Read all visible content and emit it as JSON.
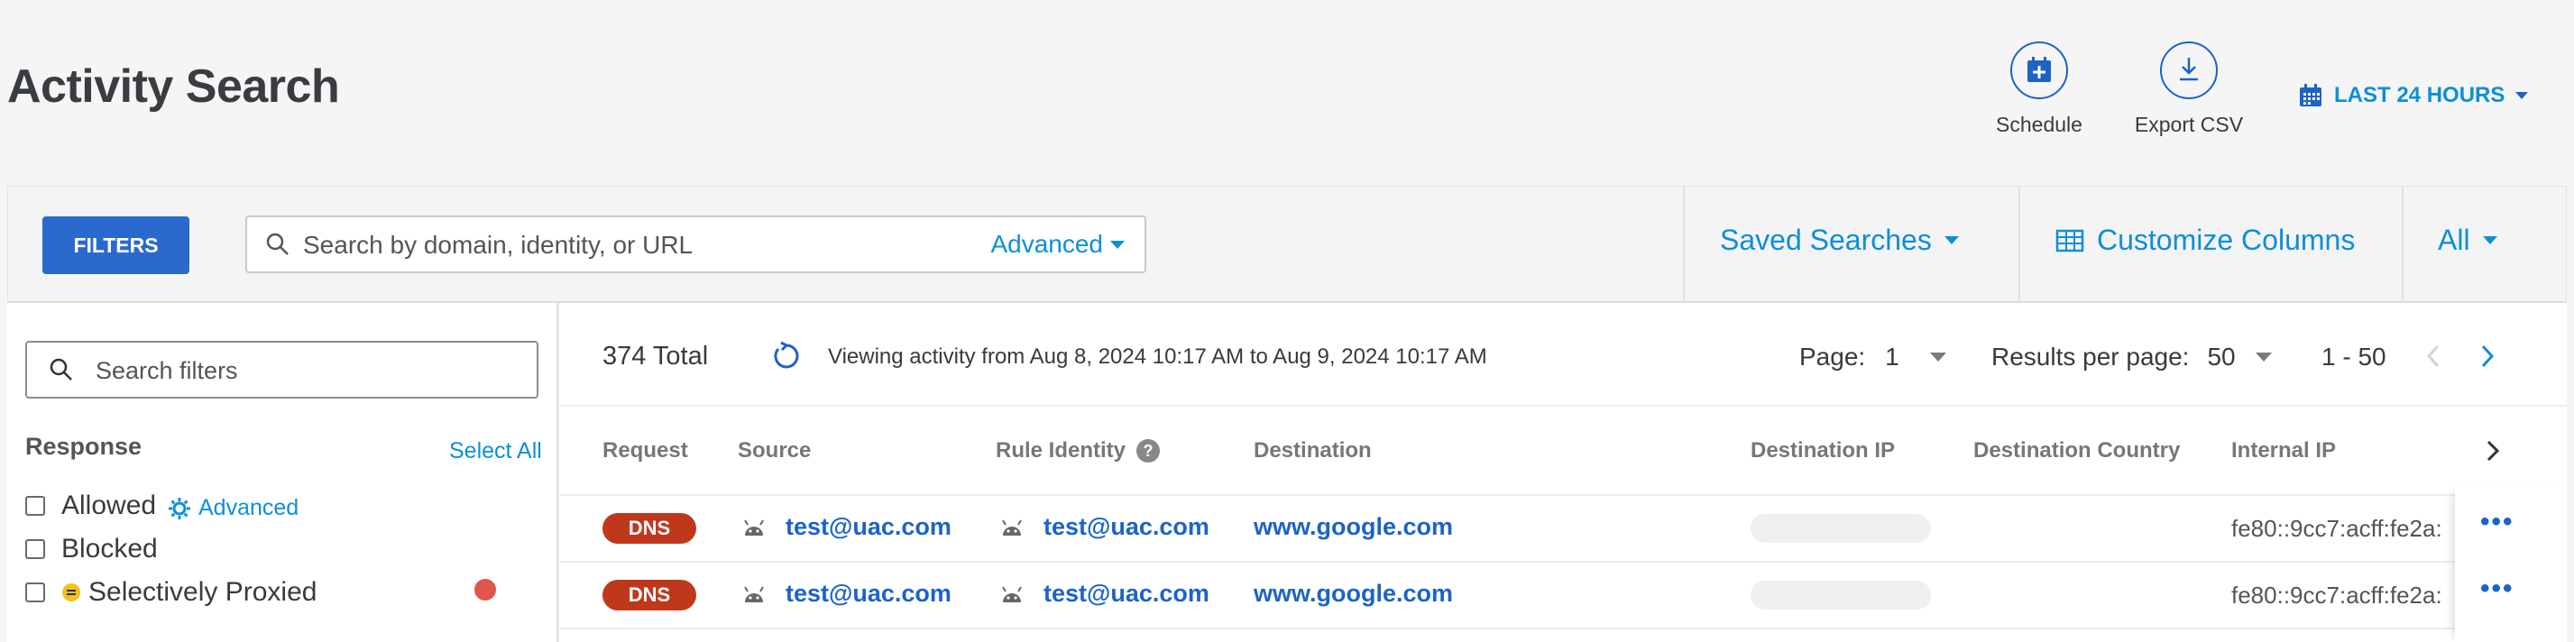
{
  "header": {
    "title": "Activity Search",
    "schedule_label": "Schedule",
    "export_label": "Export CSV",
    "time_range": "LAST 24 HOURS"
  },
  "toolbar": {
    "filters_label": "FILTERS",
    "search_placeholder": "Search by domain, identity, or URL",
    "advanced_label": "Advanced",
    "saved_searches": "Saved Searches",
    "customize_columns": "Customize Columns",
    "all_label": "All"
  },
  "sidebar": {
    "filter_placeholder": "Search filters",
    "section_title": "Response",
    "select_all": "Select All",
    "options": [
      {
        "label": "Allowed",
        "checked": false
      },
      {
        "label": "Blocked",
        "checked": false
      },
      {
        "label": "Selectively Proxied",
        "checked": false
      }
    ],
    "advanced_label": "Advanced"
  },
  "results": {
    "total": "374 Total",
    "viewing": "Viewing activity from Aug 8, 2024 10:17 AM to Aug 9, 2024 10:17 AM",
    "page_label": "Page:",
    "page_value": "1",
    "per_page_label": "Results per page:",
    "per_page_value": "50",
    "range": "1 - 50"
  },
  "table": {
    "columns": [
      "Request",
      "Source",
      "Rule Identity",
      "Destination",
      "Destination IP",
      "Destination Country",
      "Internal IP"
    ],
    "rows": [
      {
        "request": "DNS",
        "source": "test@uac.com",
        "rule_identity": "test@uac.com",
        "destination": "www.google.com",
        "internal_ip": "fe80::9cc7:acff:fe2a:"
      },
      {
        "request": "DNS",
        "source": "test@uac.com",
        "rule_identity": "test@uac.com",
        "destination": "www.google.com",
        "internal_ip": "fe80::9cc7:acff:fe2a:"
      }
    ]
  },
  "colors": {
    "primary": "#2a6acf",
    "link": "#0d8fd6",
    "dns_badge": "#c0381b",
    "warning_dot": "#e0564a"
  }
}
